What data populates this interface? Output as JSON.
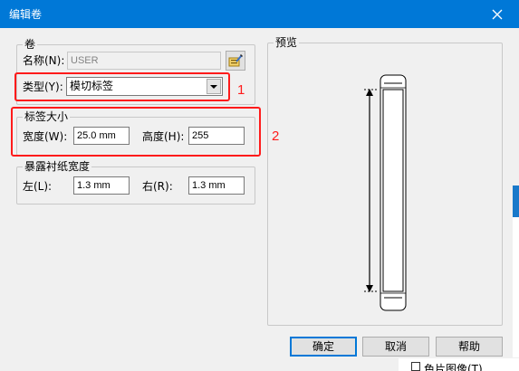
{
  "window": {
    "title": "编辑卷"
  },
  "roll_group": {
    "legend": "卷",
    "name_label": "名称(N):",
    "name_value": "USER",
    "type_label": "类型(Y):",
    "type_value": "模切标签"
  },
  "label_size": {
    "legend": "标签大小",
    "width_label": "宽度(W):",
    "width_value": "25.0 mm",
    "height_label": "高度(H):",
    "height_value": "255"
  },
  "liner": {
    "legend": "暴露衬纸宽度",
    "left_label": "左(L):",
    "left_value": "1.3 mm",
    "right_label": "右(R):",
    "right_value": "1.3 mm"
  },
  "preview": {
    "legend": "预览"
  },
  "buttons": {
    "ok": "确定",
    "cancel": "取消",
    "help": "帮助"
  },
  "annotations": {
    "marker1": "1",
    "marker2": "2",
    "color": "#ff1b1b"
  },
  "background": {
    "partial_text": "色片图像(T)"
  },
  "colors": {
    "titlebar": "#0078d7",
    "dialog_bg": "#f0f0f0"
  }
}
